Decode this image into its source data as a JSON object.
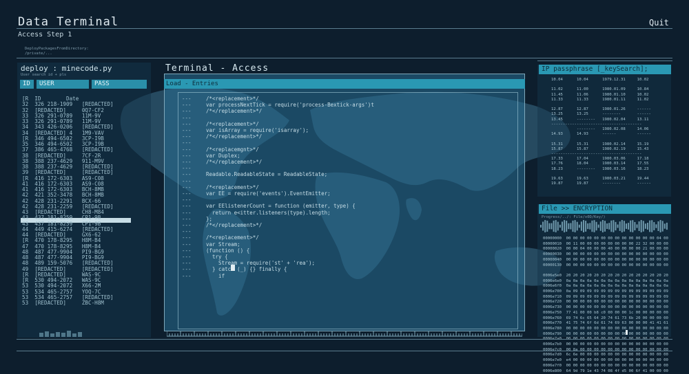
{
  "app": {
    "title": "Data Terminal",
    "quit_label": "Quit",
    "step": "Access Step 1",
    "deploy_note": "DeployPackagesFromDirectory:\n/private/..."
  },
  "colors": {
    "background": "#0d1e2d",
    "accent": "#2a98b3",
    "text": "#b9d3df"
  },
  "left_panel": {
    "title": "deploy : minecode.py",
    "subtitle": "User search id + pls",
    "columns": [
      "ID",
      "USER",
      "PASS"
    ],
    "rows": [
      "[R  ID        Date",
      "32  326 218-1909   [REDACTED]",
      "32  [REDACTED]     0Q7-CF2",
      "33  326 291-0789   11M-9V",
      "33  326 291-0789   11M-9V",
      "34  343 426-0206   [REDACTED]",
      "34  [REDACTED] 4   1M9-VAV",
      "[R  346 494-6502   3CP-I9B",
      "35  346 494-6502   3CP-I9B",
      "37  386 465-4768   [REDACTED]",
      "38  [REDACTED]     7CF-2R",
      "38  388 237-4629   911-M9V",
      "38  388 237-4629   [REDACTED]",
      "39  [REDACTED]     [REDACTED]",
      "[R  416 172-6303   AS9-C08",
      "41  416 172-6303   AS9-C08",
      "41  416 172-6303   BCH-8MB",
      "42  421 352-3478   BCH-8MB",
      "42  428 231-2291   BCX-66",
      "42  428 231-2259   [REDACTED]",
      "43  [REDACTED]     CH8-M84",
      "43  437 181-8259   CP1-9B",
      "43  437 181-8259   CP1-9B",
      "44  449 415-6274   [REDACTED]",
      "44  [REDACTED]     GX6-62",
      "[R  470 178-8295   H8M-B4",
      "47  470 178-8295   H8M-B4",
      "48  487 477-9904   PI9-BG9",
      "48  487 477-9904   PI9-BG9",
      "48  489 159-5076   [REDACTED]",
      "49  [REDACTED]     [REDACTED]",
      "[R  [REDACTED]     WAS-9C",
      "[R  530 494-2072   WAS-9C",
      "53  530 494-2072   X66-2M",
      "53  534 465-2757   YOQ-7C",
      "53  534 465-2757   [REDACTED]",
      "53  [REDACTED]     ZBC-H8M"
    ]
  },
  "terminal": {
    "title": "Terminal - Access",
    "bar_label": "Load - Entries",
    "code_lines": [
      "/*<replacement>*/",
      "var processNextTick = require('process-Bextick-args')t",
      "/*</replacement>*/",
      "",
      "/*<replacement>*/",
      "var isArray = require('isarray');",
      "/*</replacement>*/",
      "",
      "/*<replacemgnt>*/",
      "var Duplex;",
      "/*</replacement>*/",
      "",
      "Readable.ReadableState = ReadableState;",
      "",
      "/*<replacement>*/",
      "var EE = require('events').EventEmitter;",
      "",
      "var EElistenerCount = function (emitter, type) {",
      "  return e<itter.listeners(type).length;",
      "};",
      "/*</replacement>*/",
      "",
      "/*<replacement>*/",
      "var Stream;",
      "(function () {",
      "  try {",
      "    Stream = require('st' + 'rea');",
      "  } catch (_) {} finally {",
      "    if"
    ],
    "gutter": "---"
  },
  "ip_panel": {
    "title": "IP passphrase [_keySearch];",
    "rows": [
      "10.04      10.04      1979.12.31     10.02",
      "",
      "11.02      11.00      1980.01.09     10.84",
      "11.45      11.06      1980.01.10     10.02",
      "11.33      11.33      1980.01.11     11.02",
      "",
      "12.87      12.87      1980.01.26     ------",
      "13.25      13.25      --------       ------",
      "13.45      --------   1980.02.04     13.11",
      "---------------------------------------",
      "           --------   1980.02.08     14.06",
      "14.93      14.93      ------         ------",
      "",
      "15.31      15.31      1980.02.14     15.19",
      "15.87      15.87      1980.02.19     15.43",
      "---------------------------------------",
      "17.33      17.04      1980.03.06     17.18",
      "17.76      18.04      1980.03.14     17.55",
      "18.23      --------   1980.03.16     18.23",
      "",
      "19.63      19.63      1980.03.21     19.44",
      "19.87      19.87      --------       ------"
    ]
  },
  "encryption": {
    "title": "File >> ENCRYPTION",
    "progress_label": "Progress/../:  File/x0D/Key/)",
    "hex_rows": [
      "00000000  00 00 00 00 00 00 00 00 00 00 00 00 00 04 00",
      "00000010  00 11 00 00 00 00 00 00 00 00 22 32 00 00 00",
      "00000020  00 00 04 00 00 00 40 00 00 00 00 21 00 00 00",
      "00000030  00 00 00 00 00 00 00 00 00 00 00 00 00 00 00",
      "00000040  00 00 00 00 00 00 00 00 00 00 00 00 00 00 00",
      "00000130  00 00 00 00 00 00 00 00 00 00 00 00 00 00 00",
      "",
      "0006e5e0  20 20 20 20 20 20 20 20 20 20 20 20 20 20 20",
      "0006e6e0  0a 0a 0a 0a 0a 0a 0a 0a 0a 0a 0a 0a 0a 0a 0a",
      "0006e6f0  0a 0a 0a 0a 0a 0a 0a 0a 0a 0a 0a 0a 0a 0a 0a",
      "0006e700  0a 09 09 09 09 09 09 09 09 09 09 09 09 09 09",
      "0006e710  09 09 09 09 09 09 09 09 09 09 09 09 09 09 09",
      "0006e720  00 00 00 00 00 00 00 00 00 00 00 00 00 00 00",
      "0006e730  00 00 00 00 00 00 00 00 00 00 00 00 00 00 00",
      "0006e750  77 41 00 00 b8 c0 00 00 00 1c 00 00 00 00 00",
      "0006e760  69 74 6c 65 64 20 74 61 73 6b 20 00 00 00 00",
      "0006e770  41 75 74 6f 6d 61 74 69 63 00 00 00 41 41 61",
      "0006e780  00 00 00 00 00 00 00 00 00 00 00 00 00 00 00",
      "0006e790  00 00 00 00 00 00 00 00 00 00 00 00 00 00 00",
      "0006e7a0  00 00 00 00 00 00 00 00 00 00 00 00 00 00 00",
      "0006e7b0  00 00 00 00 00 00 00 00 00 00 00 00 00 00 00",
      "0006e7c0  00 8a 00 00 00 00 00 00 00 00 00 00 00 00 00",
      "0006e7d0  6c 6e 00 00 00 00 00 00 00 00 00 00 00 00 00",
      "0006e7e0  e4 00 00 00 00 00 00 00 00 00 00 00 00 00 00",
      "0006e7f0  00 00 00 00 00 00 00 00 00 00 00 00 00 00 00",
      "0006e800  64 9d 79 1e 43 74 08 4f d5 00 6f 41 00 00 00"
    ]
  }
}
